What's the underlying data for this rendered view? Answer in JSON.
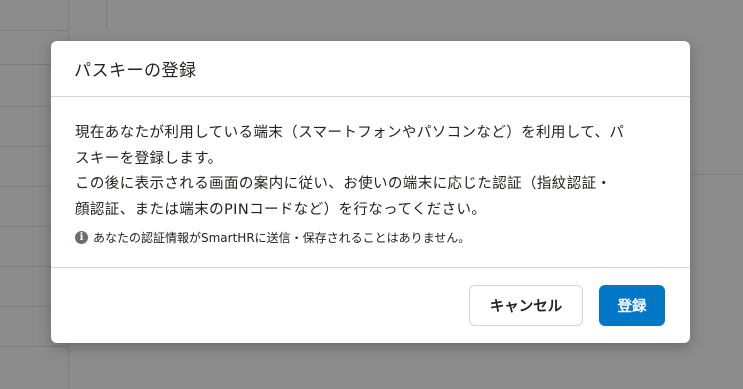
{
  "dialog": {
    "title": "パスキーの登録",
    "description_lines": [
      "現在あなたが利用している端末（スマートフォンやパソコンなど）を利用して、パ",
      "スキーを登録します。",
      "この後に表示される画面の案内に従い、お使いの端末に応じた認証（指紋認証・",
      "顔認証、または端末のPINコードなど）を行なってください。"
    ],
    "note": {
      "icon": "info-icon",
      "icon_glyph": "i",
      "text": "あなたの認証情報がSmartHRに送信・保存されることはありません。"
    },
    "buttons": {
      "cancel_label": "キャンセル",
      "register_label": "登録"
    }
  },
  "colors": {
    "primary": "#0077c7",
    "overlay": "#8c8c8c",
    "text": "#23221e",
    "border": "#d6d3d0"
  }
}
